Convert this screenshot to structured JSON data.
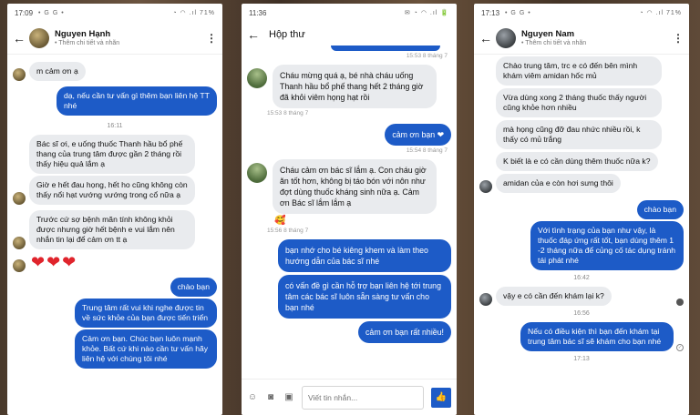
{
  "phone1": {
    "status_time": "17:09",
    "status_apps": "• G G •",
    "status_icons": "◔ ◠ .ıl 71%",
    "contact_name": "Nguyen Hạnh",
    "contact_sub": "• Thêm chi tiết và nhãn",
    "messages": {
      "m1": "m cảm ơn ạ",
      "m2": "dạ, nếu cần tư vấn gì thêm bạn liên hệ TT nhé",
      "time1": "16:11",
      "m3": "Bác sĩ ơi, e uống thuốc Thanh hầu bổ phế thang của trung tâm được gần 2 tháng rồi thấy hiệu quả lắm ạ",
      "m4": "Giờ e hết đau họng, hết ho cũng không còn thấy nổi hạt vướng vướng trong cổ nữa ạ",
      "m5": "Trước cứ sợ bệnh mãn tính không khỏi được nhưng giờ hết bệnh e vui lắm nên nhắn tin lại để cảm ơn tt ạ",
      "hearts": "❤❤❤",
      "m6": "chào bạn",
      "m7": "Trung tâm rất vui khi nghe được tin về sức khỏe của bạn được tiến triển",
      "m8": "Cảm ơn bạn. Chúc bạn luôn mạnh khỏe. Bất cứ khi nào cần tư vấn hãy liên hệ với chúng tôi nhé"
    }
  },
  "phone2": {
    "status_time": "11:36",
    "status_icons": "✉ ◔ ◠ .ıl 🔋",
    "title": "Hộp thư",
    "messages": {
      "stamp0": "15:53 8 tháng 7",
      "m1": "Cháu mừng quá ạ, bé nhà cháu uống Thanh hầu bổ phế thang hết 2 tháng giờ đã khỏi viêm họng hạt rồi",
      "stamp1": "15:53 8 tháng 7",
      "m2": "cảm ơn bạn ❤",
      "stamp2": "15:54 8 tháng 7",
      "m3": "Cháu cảm ơn bác sĩ lắm ạ. Con cháu giờ ăn tốt hơn, không bị táo bón với nôn như đợt dùng thuốc kháng sinh nữa ạ. Cảm ơn Bác sĩ lắm lắm ạ",
      "emoji": "🥰",
      "stamp3": "15:56 8 tháng 7",
      "m4": "bạn nhớ cho bé kiêng khem và làm theo hướng dẫn của bác sĩ nhé",
      "m5": "có vấn đề gì cần hỗ trợ bạn liên hệ tới trung tâm các bác sĩ luôn sẵn sàng tư vấn cho bạn nhé",
      "m6": "cảm ơn bạn rất nhiều!"
    },
    "input_placeholder": "Viết tin nhắn..."
  },
  "phone3": {
    "status_time": "17:13",
    "status_apps": "• G G •",
    "status_icons": "◔ ◠ .ıl 71%",
    "contact_name": "Nguyen Nam",
    "contact_sub": "• Thêm chi tiết và nhãn",
    "messages": {
      "m1": "Chào trung tâm, trc e có đến bên mình khám viêm amidan hốc mủ",
      "m2": "Vừa dùng xong 2 tháng thuốc thấy người cũng khỏe hơn nhiều",
      "m3": "mà họng cũng đỡ đau nhức nhiều rồi, k thấy có mủ trắng",
      "m4": "K biết là e có cần dùng thêm thuốc nữa k?",
      "m5": "amidan của e còn hơi sưng thôi",
      "m6": "chào bạn",
      "m7": "Với tình trạng của bạn như vậy, là thuốc đáp ứng rất tốt, bạn dùng thêm 1 -2 tháng nữa để củng cố tác dụng tránh tái phát nhé",
      "time1": "16:42",
      "m8": "vậy e có cần đến khám lại k?",
      "time2": "16:56",
      "m9": "Nếu có điều kiện thì bạn đến khám tại trung tâm bác sĩ sẽ khám cho bạn nhé",
      "time3": "17:13"
    }
  },
  "colors": {
    "outgoing": "#1d5bc7",
    "incoming": "#e9ebee"
  }
}
